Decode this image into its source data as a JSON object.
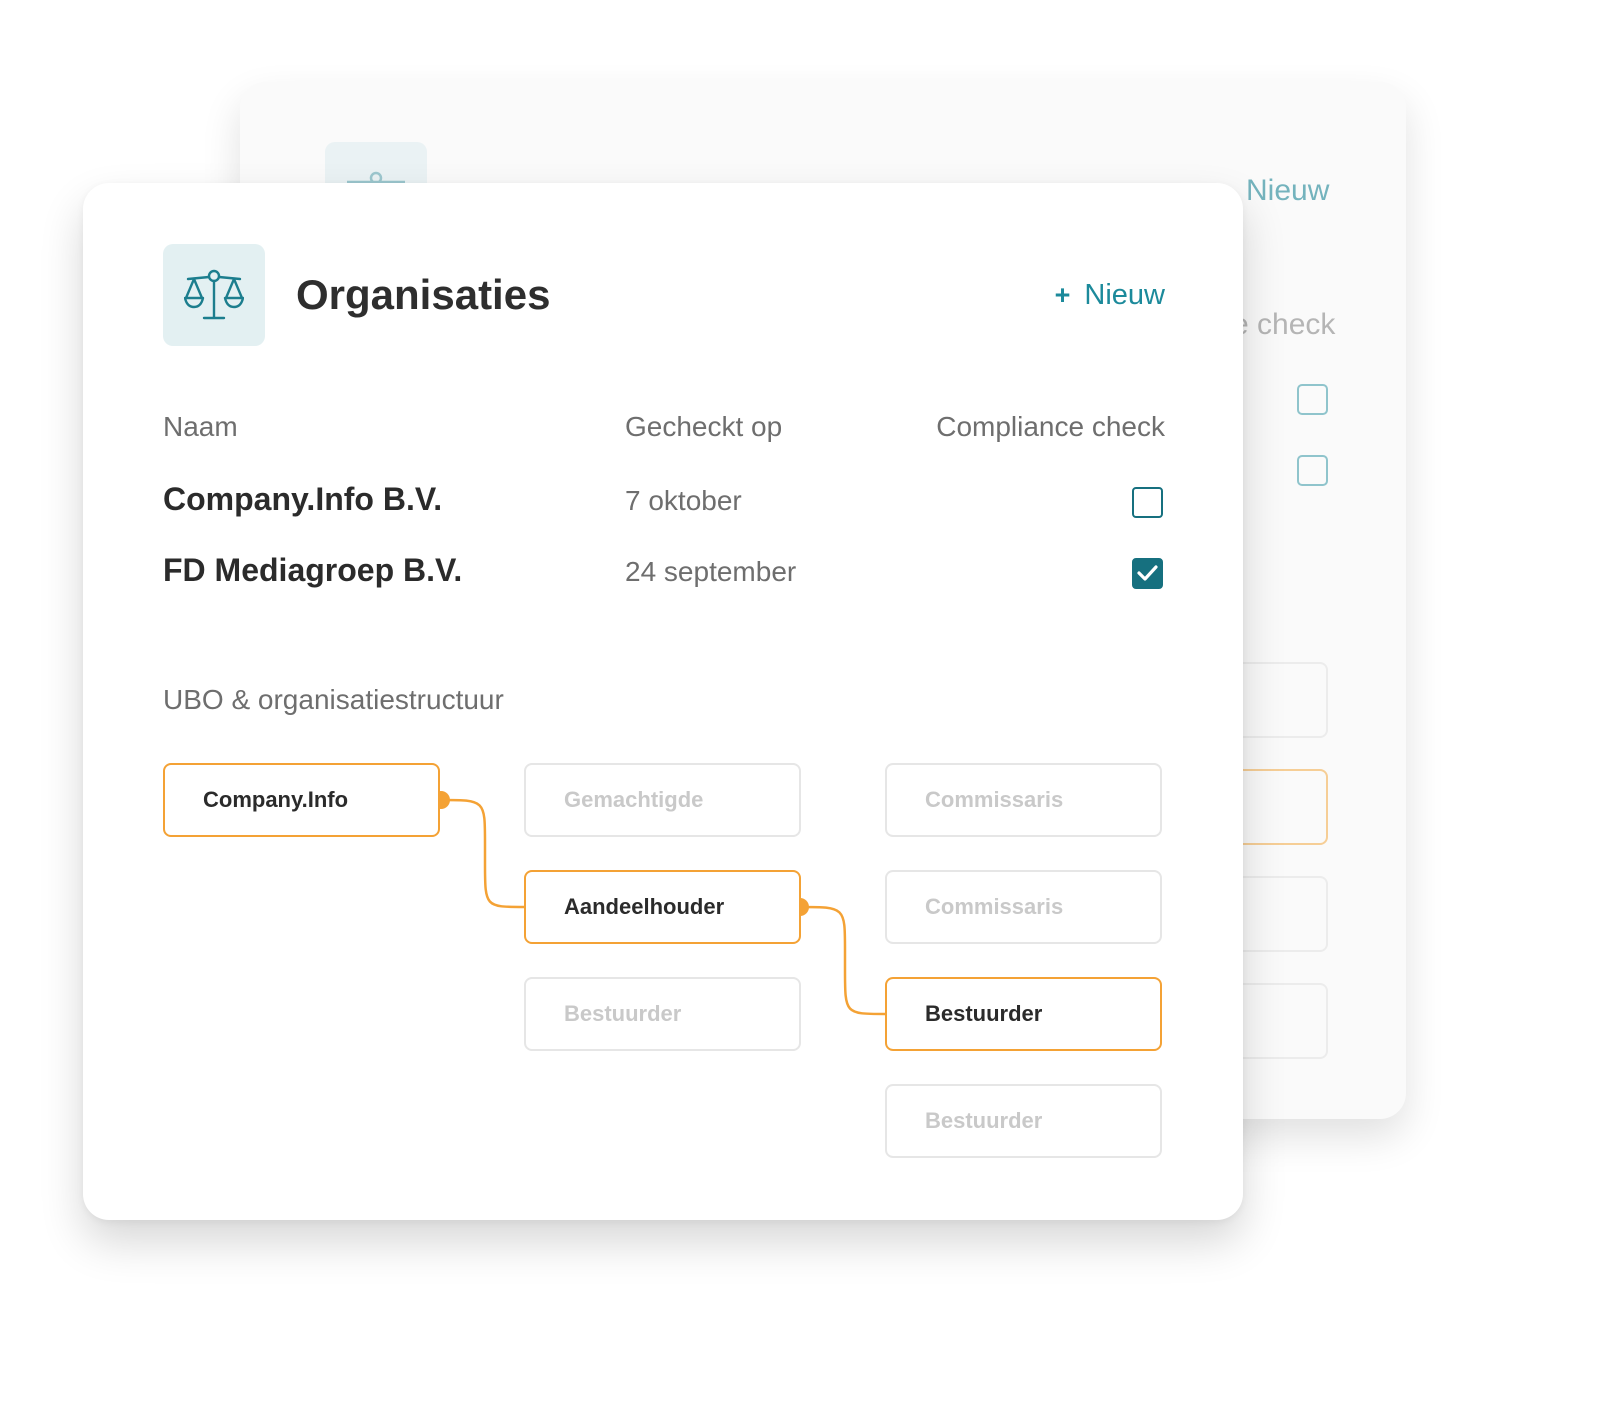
{
  "colors": {
    "accent_teal": "#16707f",
    "accent_orange": "#f4a235",
    "tile_bg": "#e3f0f2"
  },
  "back_card": {
    "header_icon": "scales-icon",
    "new_label": "Nieuw",
    "column_fragment": "e check"
  },
  "header": {
    "icon": "scales-icon",
    "title": "Organisaties",
    "new_plus": "+",
    "new_label": "Nieuw"
  },
  "table": {
    "columns": [
      "Naam",
      "Gecheckt op",
      "Compliance check"
    ],
    "rows": [
      {
        "name": "Company.Info B.V.",
        "date": "7 oktober",
        "compliance_checked": false
      },
      {
        "name": "FD Mediagroep B.V.",
        "date": "24 september",
        "compliance_checked": true
      }
    ]
  },
  "ubo": {
    "label": "UBO & organisatiestructuur",
    "columns": [
      [
        {
          "label": "Company.Info",
          "active": true
        }
      ],
      [
        {
          "label": "Gemachtigde",
          "active": false
        },
        {
          "label": "Aandeelhouder",
          "active": true
        },
        {
          "label": "Bestuurder",
          "active": false
        }
      ],
      [
        {
          "label": "Commissaris",
          "active": false
        },
        {
          "label": "Commissaris",
          "active": false
        },
        {
          "label": "Bestuurder",
          "active": true
        },
        {
          "label": "Bestuurder",
          "active": false
        }
      ]
    ]
  }
}
